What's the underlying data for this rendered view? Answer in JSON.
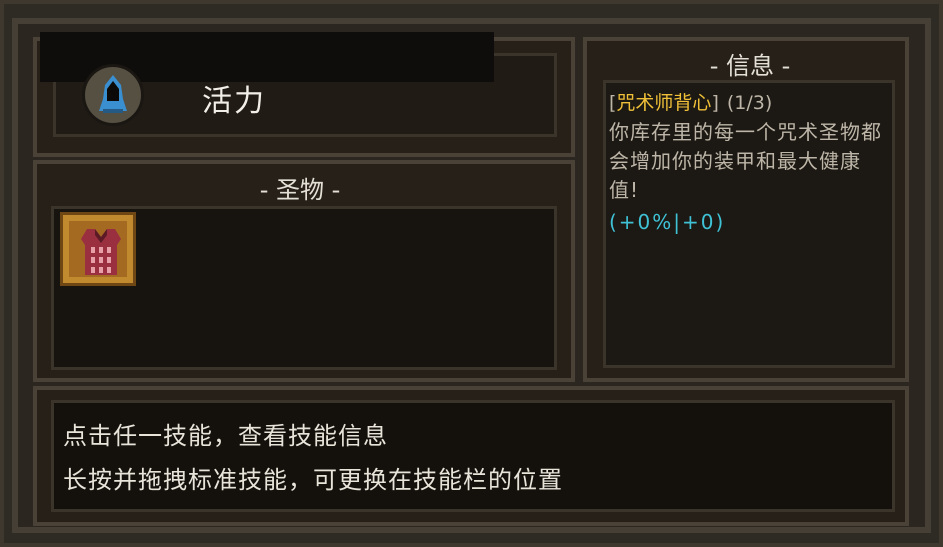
{
  "skill": {
    "title": "活力",
    "icon": "hooded-figure-icon"
  },
  "relics": {
    "section_title": "- 圣物 -",
    "items": [
      {
        "name": "咒术师背心",
        "icon": "vest-icon"
      }
    ]
  },
  "info": {
    "section_title": "- 信息 -",
    "bracket_open": "[",
    "relic_name": "咒术师背心",
    "bracket_close": "]",
    "count": "(1/3)",
    "description": "你库存里的每一个咒术圣物都会增加你的装甲和最大健康值!",
    "stats": "(+0%|+0)"
  },
  "hints": {
    "line1": "点击任一技能，查看技能信息",
    "line2": "长按并拖拽标准技能，可更换在技能栏的位置"
  },
  "colors": {
    "relic_name": "#f0c038",
    "stats": "#3fc2d6",
    "relic_slot": "#c28a2e"
  }
}
